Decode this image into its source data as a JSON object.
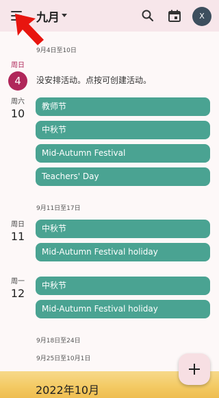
{
  "header": {
    "month": "九月",
    "menu_icon": "hamburger-menu-icon",
    "search_icon": "search-icon",
    "today_icon": "calendar-today-icon",
    "avatar_initial": "X"
  },
  "weeks": [
    {
      "range": "9月4日至10日",
      "days": [
        {
          "dow": "周日",
          "date": "4",
          "is_today": true,
          "empty_message": "没安排活动。点按可创建活动。",
          "events": []
        },
        {
          "dow": "周六",
          "date": "10",
          "is_today": false,
          "events": [
            "教师节",
            "中秋节",
            "Mid-Autumn Festival",
            "Teachers' Day"
          ]
        }
      ]
    },
    {
      "range": "9月11日至17日",
      "days": [
        {
          "dow": "周日",
          "date": "11",
          "is_today": false,
          "events": [
            "中秋节",
            "Mid-Autumn Festival holiday"
          ]
        },
        {
          "dow": "周一",
          "date": "12",
          "is_today": false,
          "events": [
            "中秋节",
            "Mid-Autumn Festival holiday"
          ]
        }
      ]
    },
    {
      "range": "9月18日至24日"
    },
    {
      "range": "9月25日至10月1日"
    }
  ],
  "next_month_banner": "2022年10月",
  "fab_icon": "add-icon",
  "colors": {
    "event": "#4aa392",
    "today": "#b0275a",
    "topbar": "#f7e6ea",
    "arrow": "#e8150f"
  }
}
